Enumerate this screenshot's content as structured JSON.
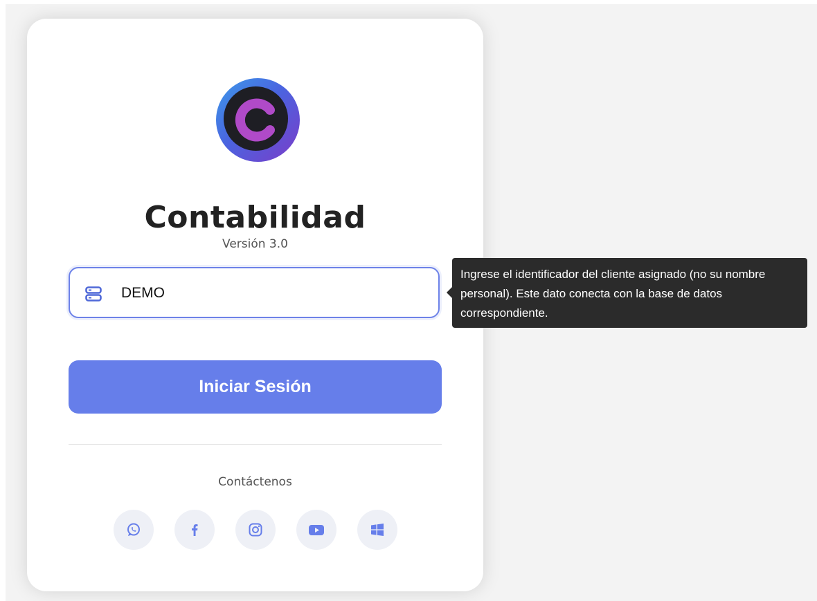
{
  "app": {
    "title": "Contabilidad",
    "version": "Versión 3.0"
  },
  "client_field": {
    "value": "DEMO",
    "icon": "database-icon"
  },
  "tooltip": {
    "text": "Ingrese el identificador del cliente asignado (no su nombre personal). Este dato conecta con la base de datos correspondiente."
  },
  "login": {
    "button_label": "Iniciar Sesión"
  },
  "contact": {
    "label": "Contáctenos",
    "links": [
      {
        "icon": "whatsapp-icon"
      },
      {
        "icon": "facebook-icon"
      },
      {
        "icon": "instagram-icon"
      },
      {
        "icon": "youtube-icon"
      },
      {
        "icon": "windows-icon"
      }
    ]
  },
  "colors": {
    "accent": "#667eea",
    "tooltip_bg": "#2b2b2b",
    "logo_c": "#b04ac8"
  }
}
